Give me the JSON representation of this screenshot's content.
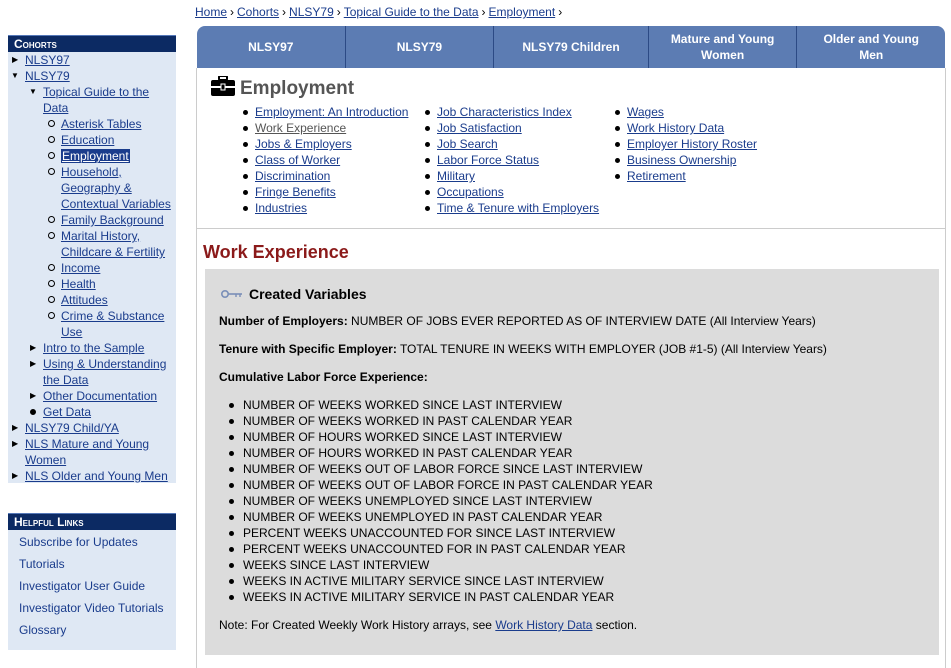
{
  "breadcrumb": {
    "items": [
      "Home",
      "Cohorts",
      "NLSY79",
      "Topical Guide to the Data",
      "Employment"
    ],
    "sep": "›"
  },
  "sidebar": {
    "cohorts_title": "Cohorts",
    "nlsy97": "NLSY97",
    "nlsy79": "NLSY79",
    "topical_guide": [
      "Topical Guide to the",
      "Data"
    ],
    "topics": [
      [
        "Asterisk Tables"
      ],
      [
        "Education"
      ],
      [
        "Employment"
      ],
      [
        "Household,",
        "Geography &",
        "Contextual Variables"
      ],
      [
        "Family Background"
      ],
      [
        "Marital History,",
        "Childcare & Fertility"
      ],
      [
        "Income"
      ],
      [
        "Health"
      ],
      [
        "Attitudes"
      ],
      [
        "Crime & Substance",
        "Use"
      ]
    ],
    "intro_sample": "Intro to the Sample",
    "using_data": [
      "Using & Understanding",
      "the Data"
    ],
    "other_docs": "Other Documentation",
    "get_data": "Get Data",
    "child_ya": "NLSY79 Child/YA",
    "mature_young": [
      "NLS Mature and Young",
      "Women"
    ],
    "older_young": "NLS Older and Young Men",
    "helpful_title": "Helpful Links",
    "helpful": [
      "Subscribe for Updates",
      "Tutorials",
      "Investigator User Guide",
      "Investigator Video Tutorials",
      "Glossary"
    ]
  },
  "tabs": [
    [
      "NLSY97"
    ],
    [
      "NLSY79"
    ],
    [
      "NLSY79 Children"
    ],
    [
      "Mature and Young",
      "Women"
    ],
    [
      "Older and Young",
      "Men"
    ]
  ],
  "employment": {
    "icon": "briefcase-icon",
    "title": "Employment",
    "col1": [
      "Employment: An Introduction",
      "Work Experience",
      "Jobs & Employers",
      "Class of Worker",
      "Discrimination",
      "Fringe Benefits",
      "Industries"
    ],
    "col2": [
      "Job Characteristics Index",
      "Job Satisfaction",
      "Job Search",
      "Labor Force Status",
      "Military",
      "Occupations",
      "Time & Tenure with Employers"
    ],
    "col3": [
      "Wages",
      "Work History Data",
      "Employer History Roster",
      "Business Ownership",
      "Retirement"
    ]
  },
  "section": {
    "title": "Work Experience",
    "cv_icon": "key-icon",
    "cv_title": "Created Variables",
    "num_emp_label": "Number of Employers:",
    "num_emp_text": " NUMBER OF JOBS EVER REPORTED AS OF INTERVIEW DATE (All Interview Years)",
    "tenure_label": "Tenure with Specific Employer:",
    "tenure_text": " TOTAL TENURE IN WEEKS WITH EMPLOYER (JOB #1-5) (All Interview Years)",
    "cum_label": "Cumulative Labor Force Experience:",
    "vars": [
      "NUMBER OF WEEKS WORKED SINCE LAST INTERVIEW",
      "NUMBER OF WEEKS WORKED IN PAST CALENDAR YEAR",
      "NUMBER OF HOURS WORKED SINCE LAST INTERVIEW",
      "NUMBER OF HOURS WORKED IN PAST CALENDAR YEAR",
      "NUMBER OF WEEKS OUT OF LABOR FORCE SINCE LAST INTERVIEW",
      "NUMBER OF WEEKS OUT OF LABOR FORCE IN PAST CALENDAR YEAR",
      "NUMBER OF WEEKS UNEMPLOYED SINCE LAST INTERVIEW",
      "NUMBER OF WEEKS UNEMPLOYED IN PAST CALENDAR YEAR",
      "PERCENT WEEKS UNACCOUNTED FOR SINCE LAST INTERVIEW",
      "PERCENT WEEKS UNACCOUNTED FOR IN PAST CALENDAR YEAR",
      "WEEKS SINCE LAST INTERVIEW",
      "WEEKS IN ACTIVE MILITARY SERVICE SINCE LAST INTERVIEW",
      "WEEKS IN ACTIVE MILITARY SERVICE IN PAST CALENDAR YEAR"
    ],
    "note_pre": "Note: For Created Weekly Work History arrays, see ",
    "note_link": "Work History Data",
    "note_post": " section."
  }
}
